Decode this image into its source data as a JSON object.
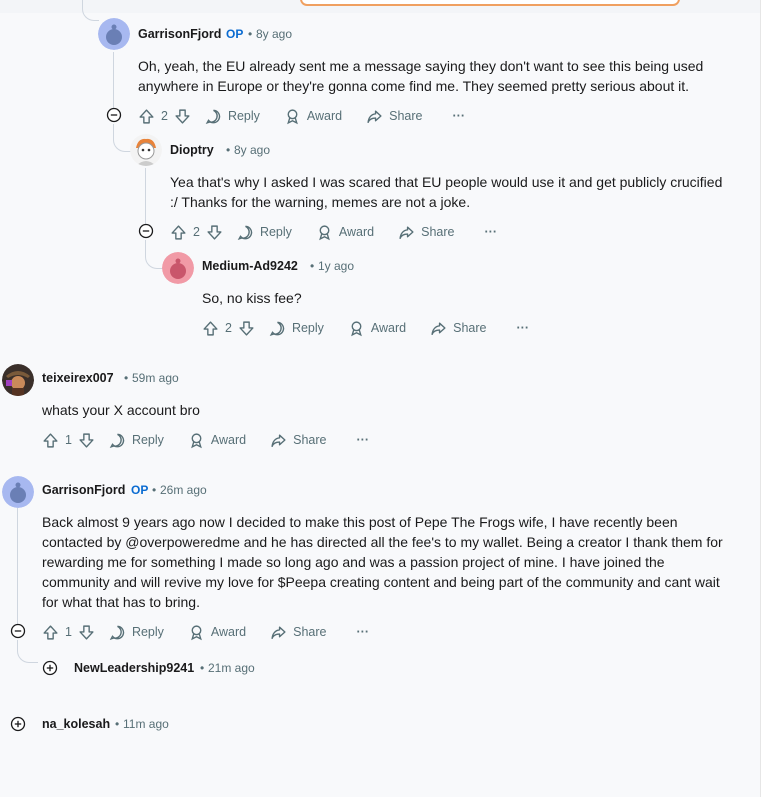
{
  "labels": {
    "reply": "Reply",
    "award": "Award",
    "share": "Share",
    "more": "···",
    "op": "OP",
    "dot": "•"
  },
  "c1": {
    "author": "GarrisonFjord",
    "time": "8y ago",
    "body": "Oh, yeah, the EU already sent me a message saying they don't want to see this being used anywhere in Europe or they're gonna come find me. They seemed pretty serious about it.",
    "votes": "2"
  },
  "c2": {
    "author": "Dioptry",
    "time": "8y ago",
    "body": "Yea that's why I asked I was scared that EU people would use it and get publicly crucified :/ Thanks for the warning, memes are not a joke.",
    "votes": "2"
  },
  "c3": {
    "author": "Medium-Ad9242",
    "time": "1y ago",
    "body": "So, no kiss fee?",
    "votes": "2"
  },
  "c4": {
    "author": "teixeirex007",
    "time": "59m ago",
    "body": "whats your X account bro",
    "votes": "1"
  },
  "c5": {
    "author": "GarrisonFjord",
    "time": "26m ago",
    "body": "Back almost 9 years ago now I decided to make this post of Pepe The Frogs wife, I have recently been contacted by @overpoweredme and he has directed all the fee's to my wallet. Being a creator I thank them for rewarding me for something I made so long ago and was a passion project of mine. I have joined the community and will revive my love for $Peepa creating content and being part of the community and cant wait for what that has to bring.",
    "votes": "1"
  },
  "c6": {
    "author": "NewLeadership9241",
    "time": "21m ago"
  },
  "c7": {
    "author": "na_kolesah",
    "time": "11m ago"
  },
  "colors": {
    "accent": "#0a6bd1",
    "meta": "#576f76",
    "thread": "#cfd6df",
    "background": "#f8f9fb"
  }
}
